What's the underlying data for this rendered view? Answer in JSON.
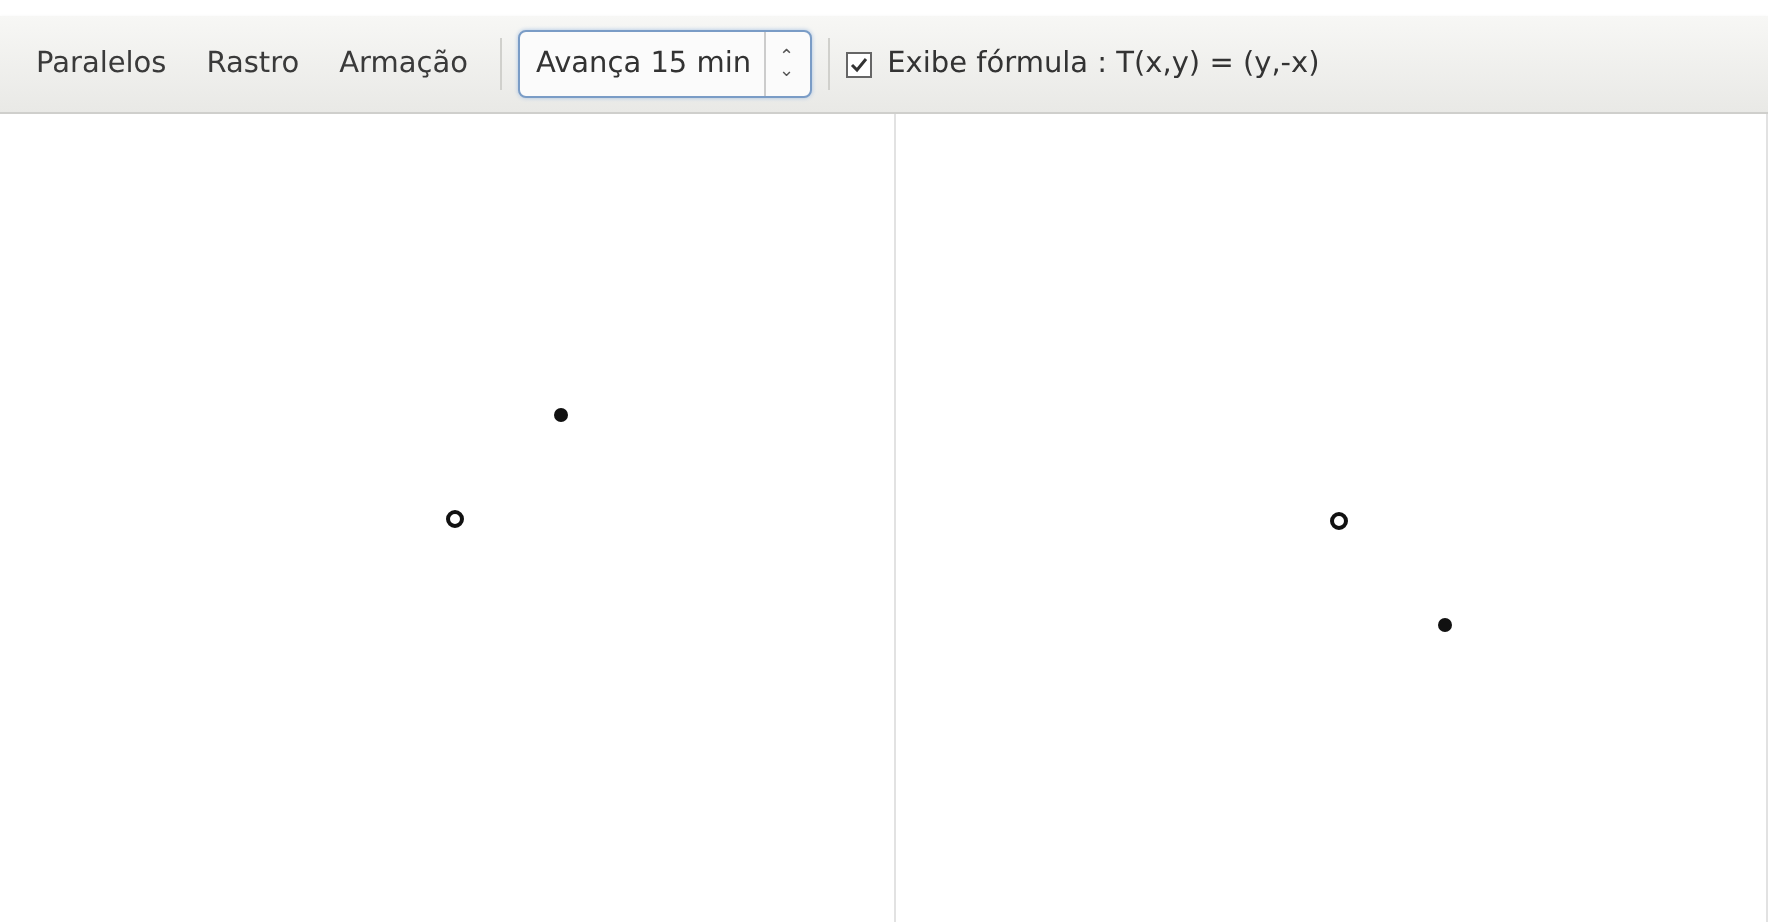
{
  "toolbar": {
    "buttons": [
      "Paralelos",
      "Rastro",
      "Armação"
    ],
    "stepper": {
      "value": "Avança 15 min",
      "arrows": "⌃⌄"
    },
    "formula": {
      "label": "Exibe fórmula : T(x,y) = (y,-x)",
      "checked": true
    }
  },
  "panels": [
    {
      "points": [
        {
          "kind": "filled"
        },
        {
          "kind": "hollow"
        }
      ]
    },
    {
      "points": [
        {
          "kind": "hollow"
        },
        {
          "kind": "filled"
        }
      ]
    }
  ]
}
